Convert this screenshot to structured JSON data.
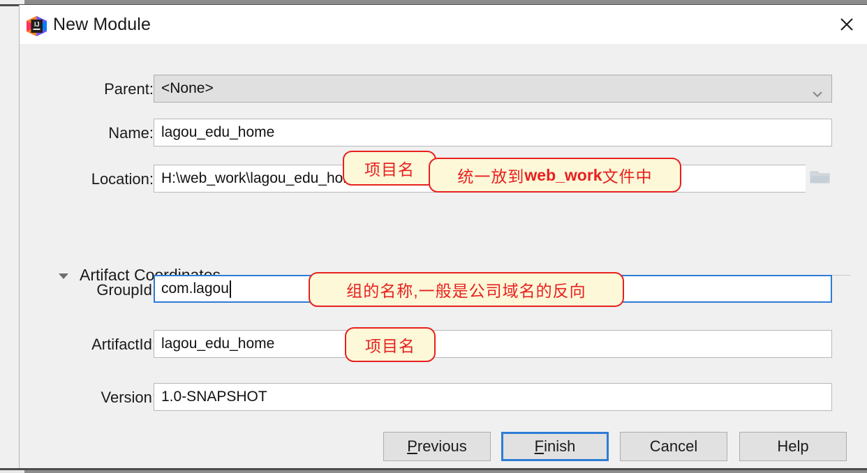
{
  "window": {
    "title": "New Module",
    "logo_icon": "intellij-idea-logo",
    "close_icon": "close-icon"
  },
  "form": {
    "parent": {
      "label": "Parent:",
      "value": "<None>",
      "dropdown_icon": "chevron-down-icon"
    },
    "name": {
      "label": "Name:",
      "value": "lagou_edu_home",
      "annotation": "项目名"
    },
    "location": {
      "label": "Location:",
      "value": "H:\\web_work\\lagou_edu_home",
      "browse_icon": "folder-icon",
      "annotation_prefix": "统一放到 ",
      "annotation_bold": "web_work",
      "annotation_suffix": "文件中"
    }
  },
  "section": {
    "title": "Artifact Coordinates",
    "toggle_icon": "triangle-down-icon",
    "expanded": true
  },
  "coordinates": {
    "group_id": {
      "label": "GroupId:",
      "value": "com.lagou",
      "focused": true,
      "annotation": "组的名称,一般是公司域名的反向"
    },
    "artifact_id": {
      "label": "ArtifactId:",
      "value": "lagou_edu_home",
      "annotation": "项目名"
    },
    "version": {
      "label": "Version:",
      "value": "1.0-SNAPSHOT"
    }
  },
  "buttons": {
    "previous": {
      "prefix": "",
      "mnemonic": "P",
      "suffix": "revious"
    },
    "finish": {
      "prefix": "",
      "mnemonic": "F",
      "suffix": "inish",
      "primary": true
    },
    "cancel": {
      "label": "Cancel"
    },
    "help": {
      "label": "Help"
    }
  },
  "colors": {
    "accent": "#2e7cd6",
    "annotation": "#e8201f",
    "annotation_bg": "#fcf8d8",
    "dialog_bg": "#f0f0f0",
    "titlebar_bg": "#ffffff"
  }
}
